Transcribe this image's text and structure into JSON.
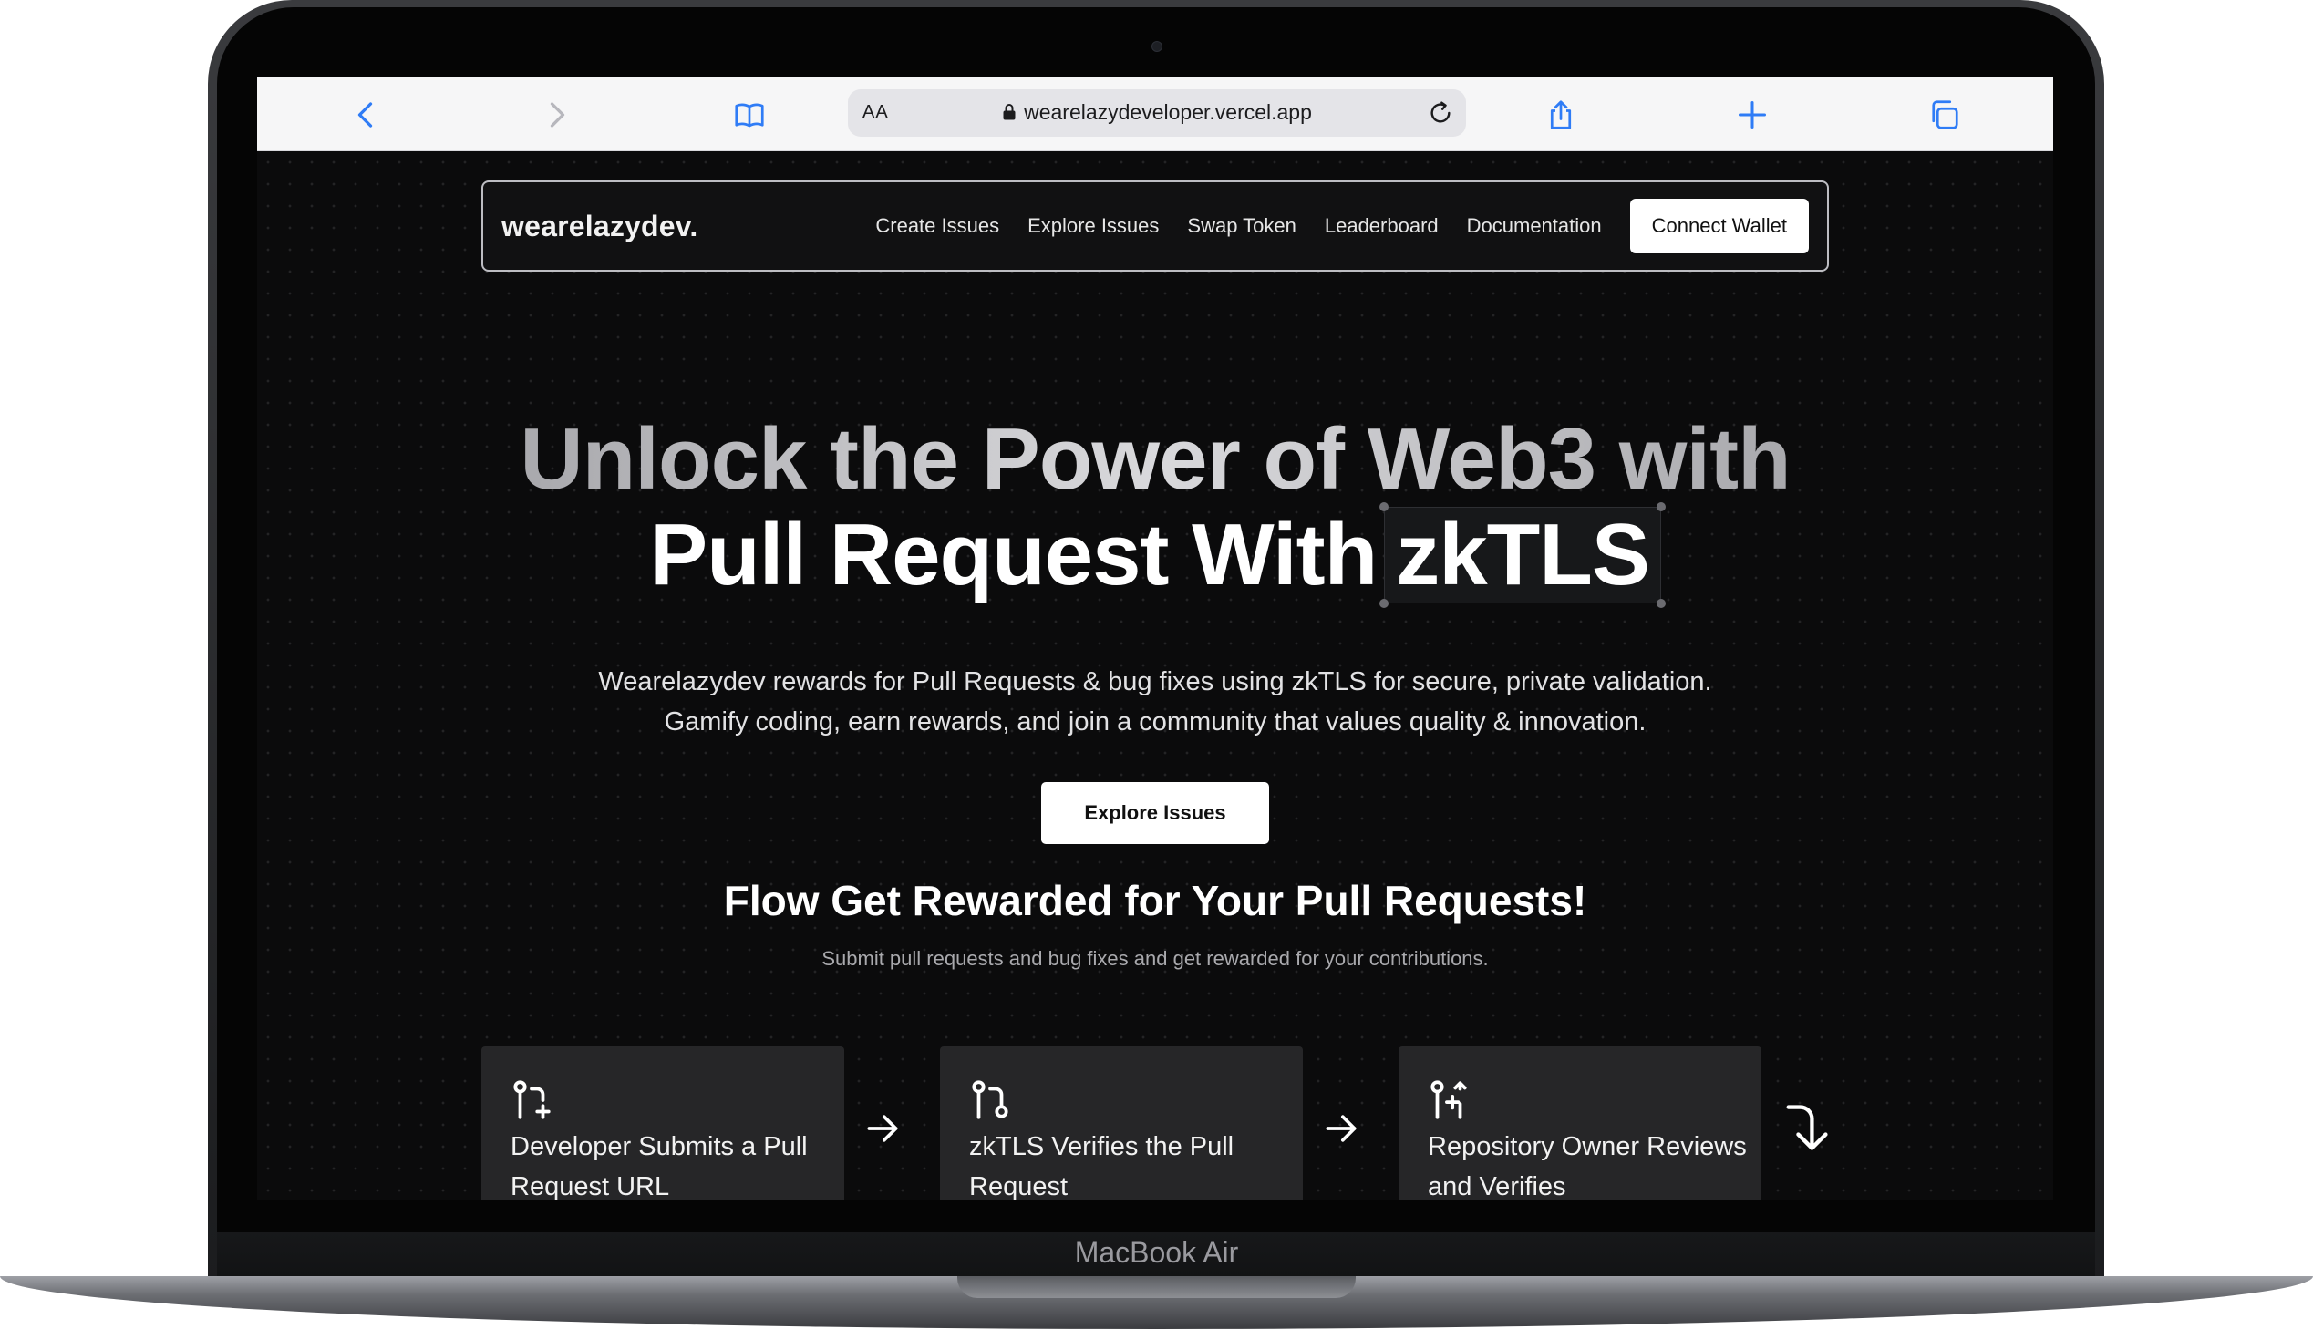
{
  "device": {
    "label": "MacBook Air"
  },
  "browser": {
    "text_size_label": "AA",
    "url": "wearelazydeveloper.vercel.app",
    "icons": [
      "back-icon",
      "forward-icon",
      "bookmarks-icon",
      "lock-icon",
      "reload-icon",
      "share-icon",
      "new-tab-icon",
      "tabs-icon"
    ]
  },
  "nav": {
    "brand": "wearelazydev.",
    "links": [
      "Create Issues",
      "Explore Issues",
      "Swap Token",
      "Leaderboard",
      "Documentation"
    ],
    "connect_label": "Connect Wallet"
  },
  "hero": {
    "line1": "Unlock the Power of Web3 with",
    "line2_prefix": "Pull Request With",
    "line2_highlight": "zkTLS",
    "description_line1": "Wearelazydev rewards for Pull Requests & bug fixes using zkTLS for secure, private validation.",
    "description_line2": "Gamify coding, earn rewards, and join a community that values quality & innovation.",
    "cta_label": "Explore Issues"
  },
  "flow": {
    "title": "Flow Get Rewarded for Your Pull Requests!",
    "subtitle": "Submit pull requests and bug fixes and get rewarded for your contributions.",
    "steps": [
      {
        "icon": "git-pull-request-create-icon",
        "label": "Developer Submits a Pull Request URL"
      },
      {
        "icon": "git-pull-request-icon",
        "label": "zkTLS Verifies the Pull Request"
      },
      {
        "icon": "git-pull-request-arrow-icon",
        "label": "Repository Owner Reviews and Verifies"
      }
    ]
  },
  "colors": {
    "page_bg": "#0b0b0c",
    "card_bg": "#262628",
    "accent_ios_blue": "#2f7cf6",
    "button_bg": "#ffffff"
  }
}
